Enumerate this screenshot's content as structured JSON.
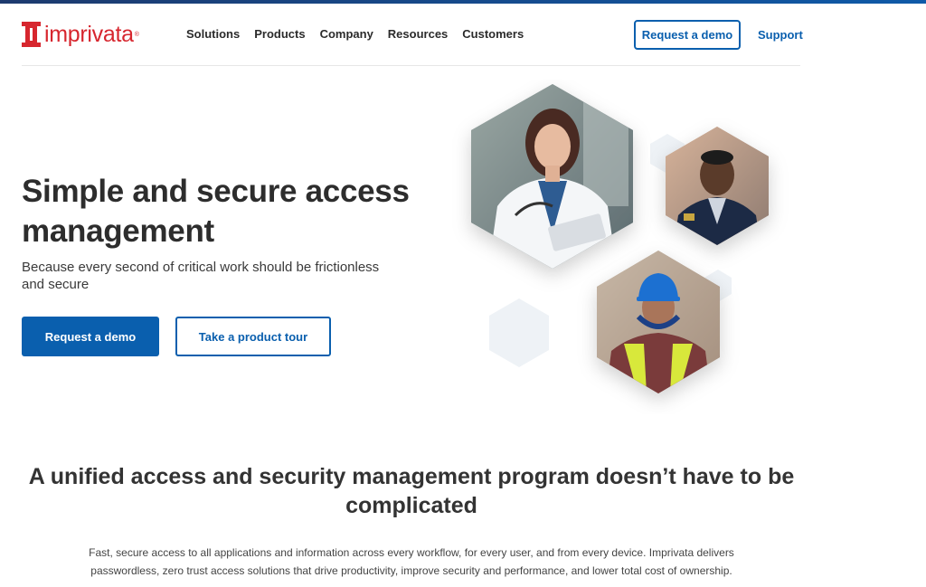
{
  "brand": {
    "name": "imprivata",
    "registered": "®",
    "color": "#d7262e"
  },
  "nav": {
    "items": [
      "Solutions",
      "Products",
      "Company",
      "Resources",
      "Customers"
    ],
    "demo_label": "Request a demo",
    "support_label": "Support"
  },
  "hero": {
    "title": "Simple and secure access management",
    "subtitle": "Because every second of critical work should be frictionless and secure",
    "primary_cta": "Request a demo",
    "secondary_cta": "Take a product tour",
    "images": [
      "doctor-photo",
      "police-officer-photo",
      "construction-worker-photo"
    ]
  },
  "section": {
    "title": "A unified access and security management program doesn’t have to be complicated",
    "body": "Fast, secure access to all applications and information across every workflow, for every user, and from every device. Imprivata delivers passwordless, zero trust access solutions that drive productivity, improve security and performance, and lower total cost of ownership."
  },
  "colors": {
    "accent": "#0a5fae",
    "text": "#2d2d2d"
  }
}
